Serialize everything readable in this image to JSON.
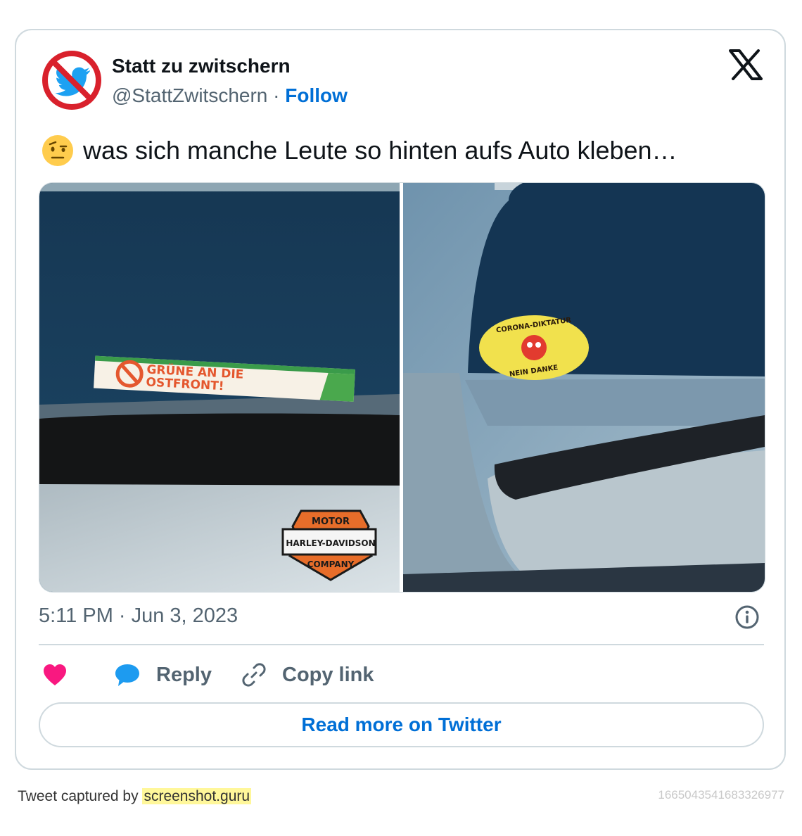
{
  "author": {
    "name": "Statt zu zwitschern",
    "handle": "@StattZwitschern",
    "separator": "·",
    "follow_label": "Follow"
  },
  "tweet": {
    "text": "was sich manche Leute so hinten aufs Auto kleben…",
    "emoji": "face-with-raised-eyebrow-emoji"
  },
  "media": {
    "left_sticker": {
      "line1": "GRÜNE AN DIE",
      "line2": "OSTFRONT!"
    },
    "harley_logo": {
      "top": "MOTOR",
      "middle": "HARLEY-DAVIDSON",
      "bottom": "COMPANY"
    },
    "right_sticker": {
      "top": "CORONA-DIKTATUR",
      "bottom": "NEIN DANKE"
    }
  },
  "meta": {
    "timestamp": "5:11 PM · Jun 3, 2023"
  },
  "actions": {
    "reply_label": "Reply",
    "copy_label": "Copy link",
    "read_more_label": "Read more on Twitter"
  },
  "footer": {
    "captured_by": "Tweet captured by",
    "site": "screenshot.guru",
    "tweet_id": "1665043541683326977"
  },
  "colors": {
    "like": "#f91880",
    "reply": "#1d9bf0",
    "link_blue": "#006fd6",
    "border": "#cfd9de",
    "muted": "#536471"
  }
}
